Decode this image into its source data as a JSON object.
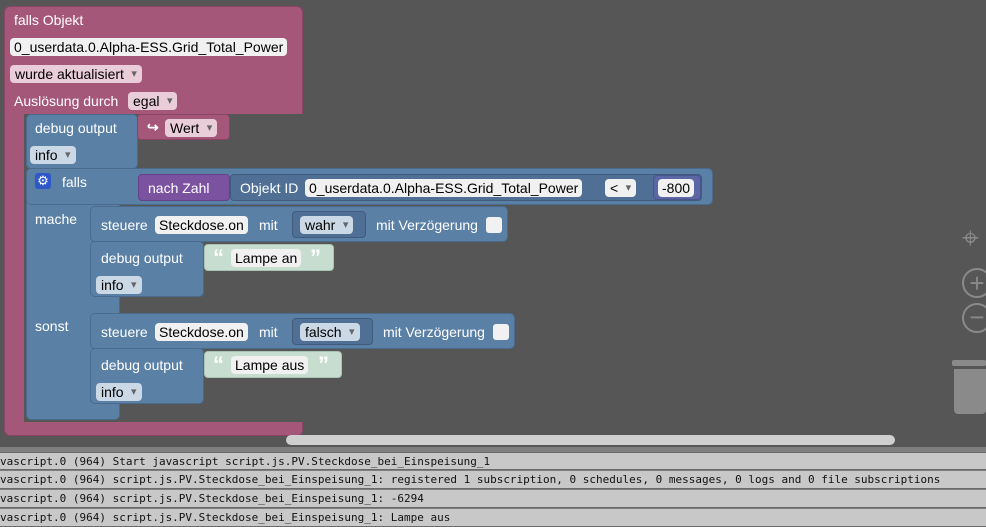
{
  "event_block": {
    "title": "falls Objekt",
    "object_id": "0_userdata.0.Alpha-ESS.Grid_Total_Power",
    "condition": "wurde aktualisiert",
    "trigger_label": "Auslösung durch",
    "trigger_value": "egal"
  },
  "debug1": {
    "label": "debug output",
    "value_block": "Wert",
    "level": "info"
  },
  "if_block": {
    "if_label": "falls",
    "do_label": "mache",
    "else_label": "sonst",
    "to_number": "nach Zahl",
    "object_id_label": "Objekt ID",
    "object_id": "0_userdata.0.Alpha-ESS.Grid_Total_Power",
    "operator": "<",
    "number": "-800"
  },
  "then_branch": {
    "control_label": "steuere",
    "device": "Steckdose.on",
    "with_label": "mit",
    "value": "wahr",
    "delay_label": "mit Verzögerung",
    "debug_label": "debug output",
    "text": "Lampe an",
    "level": "info"
  },
  "else_branch": {
    "control_label": "steuere",
    "device": "Steckdose.on",
    "with_label": "mit",
    "value": "falsch",
    "delay_label": "mit Verzögerung",
    "debug_label": "debug output",
    "text": "Lampe aus",
    "level": "info"
  },
  "log": {
    "lines": [
      "vascript.0 (964) Start javascript script.js.PV.Steckdose_bei_Einspeisung_1",
      "vascript.0 (964) script.js.PV.Steckdose_bei_Einspeisung_1: registered 1 subscription, 0 schedules, 0 messages, 0 logs and 0 file subscriptions",
      "vascript.0 (964) script.js.PV.Steckdose_bei_Einspeisung_1: -6294",
      "vascript.0 (964) script.js.PV.Steckdose_bei_Einspeisung_1: Lampe aus"
    ]
  },
  "controls": {
    "recenter": "target-icon",
    "zoom_in": "plus-icon",
    "zoom_out": "minus-icon",
    "trash": "trash-icon"
  }
}
